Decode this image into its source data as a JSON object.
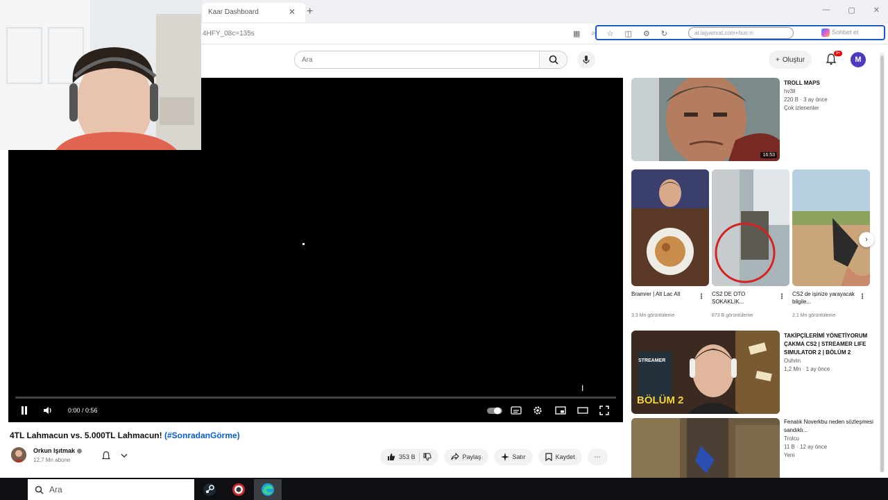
{
  "browser": {
    "tab_title": "Kaar Dashboard",
    "tab_close": "✕",
    "new_tab": "+",
    "window_controls": [
      "—",
      "▢",
      "✕"
    ],
    "faint_title": "",
    "address_fragment": "4HFY_08c=135s",
    "address_pill": "ar.lajyamrat.com+hurr.n",
    "copilot_label": "Sohbet et"
  },
  "youtube": {
    "search_placeholder": "Ara",
    "create_label": "Oluştur",
    "notif_count": "9+",
    "account_initial": "M"
  },
  "player": {
    "time": "0:00 / 0:56",
    "progress_fraction": 0.0
  },
  "video": {
    "title": "4TL Lahmacun vs. 5.000TL Lahmacun!",
    "hashtag": "(#SonradanGörme)",
    "channel_name": "Orkun Işıtmak",
    "channel_subs": "12,7 Mn abone",
    "like_count": "353 B",
    "share_label": "Paylaş",
    "thanks_label": "Satır",
    "save_label": "Kaydet",
    "more_label": "⋯"
  },
  "recommendations": [
    {
      "title": "TROLL MAPS",
      "channel": "hv3ll",
      "stats": "220 B · 3 ay önce",
      "tag": "Çok izlenenler",
      "duration": "16:53"
    },
    {
      "title": "TAKİPÇİLERİMİ YÖNETİYORUM ÇAKMA CS2 | STREAMER LIFE SIMULATOR 2 | BÖLÜM 2",
      "channel": "Ouhrin",
      "stats": "1,2 Mn · 1 ay önce",
      "thumb_text_a": "STREAMER",
      "thumb_text_b": "BÖLÜM 2"
    },
    {
      "title": "Fenalık Noverkbu neden sözleşmesi sandıklı...",
      "channel": "Trolcu",
      "stats": "11 B · 12 ay önce",
      "tag": "Yeni"
    }
  ],
  "shorts": [
    {
      "title": "Bramrer | Alt Lac Alt",
      "views": "3,3 Mn görüntüleme"
    },
    {
      "title": "CS2 DE OTO SOKAKLIK...",
      "views": "873 B görüntüleme"
    },
    {
      "title": "CS2 de işinize yarayacak bilgile...",
      "views": "2,1 Mn görüntüleme"
    }
  ],
  "taskbar": {
    "search_placeholder": "Ara"
  },
  "colors": {
    "accent_red": "#ff0000",
    "link_blue": "#065fd4",
    "avatar_purple": "#4a3bc2"
  }
}
